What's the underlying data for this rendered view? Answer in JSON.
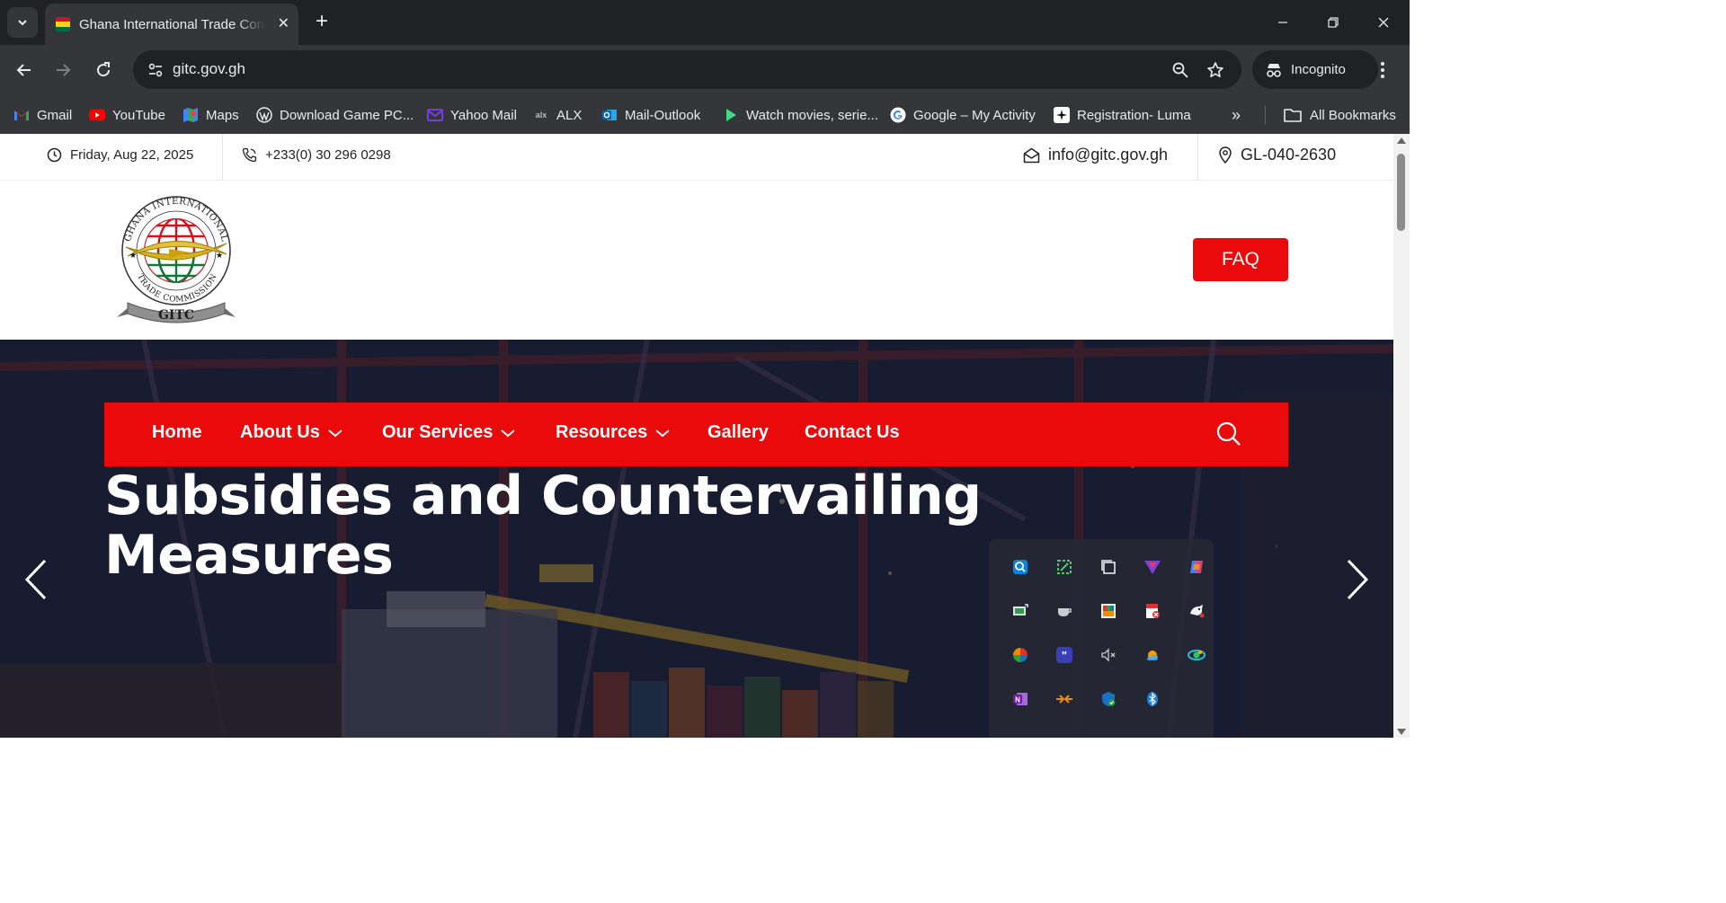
{
  "browser": {
    "tab": {
      "title": "Ghana International Trade Commission",
      "close_glyph": "✕"
    },
    "new_tab_glyph": "+",
    "url": "gitc.gov.gh",
    "incognito_label": "Incognito",
    "bookmarks": [
      {
        "label": "Gmail",
        "icon": "gmail-icon"
      },
      {
        "label": "YouTube",
        "icon": "youtube-icon"
      },
      {
        "label": "Maps",
        "icon": "maps-icon"
      },
      {
        "label": "Download Game PC...",
        "icon": "wordpress-icon"
      },
      {
        "label": "Yahoo Mail",
        "icon": "yahoo-mail-icon"
      },
      {
        "label": "ALX",
        "icon": "alx-icon"
      },
      {
        "label": "Mail-Outlook",
        "icon": "outlook-icon"
      },
      {
        "label": "Watch movies, serie...",
        "icon": "play-icon"
      },
      {
        "label": "Google – My Activity",
        "icon": "google-icon"
      },
      {
        "label": "Registration- Luma",
        "icon": "luma-icon"
      }
    ],
    "overflow_glyph": "»",
    "all_bookmarks_label": "All Bookmarks"
  },
  "topbar": {
    "date": "Friday, Aug 22, 2025",
    "phone": "+233(0) 30 296 0298",
    "email": "info@gitc.gov.gh",
    "postal": "GL-040-2630"
  },
  "header": {
    "logo_text": {
      "top_arc": "GHANA INTERNATIONAL",
      "bottom_arc": "TRADE COMMISSION",
      "ribbon": "GITC"
    },
    "faq_label": "FAQ"
  },
  "nav": {
    "items": [
      {
        "label": "Home",
        "dropdown": false
      },
      {
        "label": "About Us",
        "dropdown": true
      },
      {
        "label": "Our Services",
        "dropdown": true
      },
      {
        "label": "Resources",
        "dropdown": true
      },
      {
        "label": "Gallery",
        "dropdown": false
      },
      {
        "label": "Contact Us",
        "dropdown": false
      }
    ]
  },
  "hero": {
    "title_line1": "Subsidies and Countervailing",
    "title_line2": "Measures"
  },
  "tray_icons": [
    "search-tray-icon",
    "snipping-tool-icon",
    "multitask-icon",
    "vpn-shield-icon",
    "copilot-icon",
    "network-monitor-icon",
    "cup-icon",
    "color-picker-icon",
    "pdf-tool-icon",
    "cat-app-icon",
    "color-wheel-icon",
    "quotes-app-icon",
    "volume-muted-icon",
    "weather-icon",
    "edge-icon",
    "onenote-icon",
    "sync-arrows-icon",
    "defender-icon",
    "bluetooth-icon"
  ],
  "colors": {
    "brand_red": "#ea0a0c",
    "chrome_dark": "#202124",
    "chrome_mid": "#35363a"
  }
}
